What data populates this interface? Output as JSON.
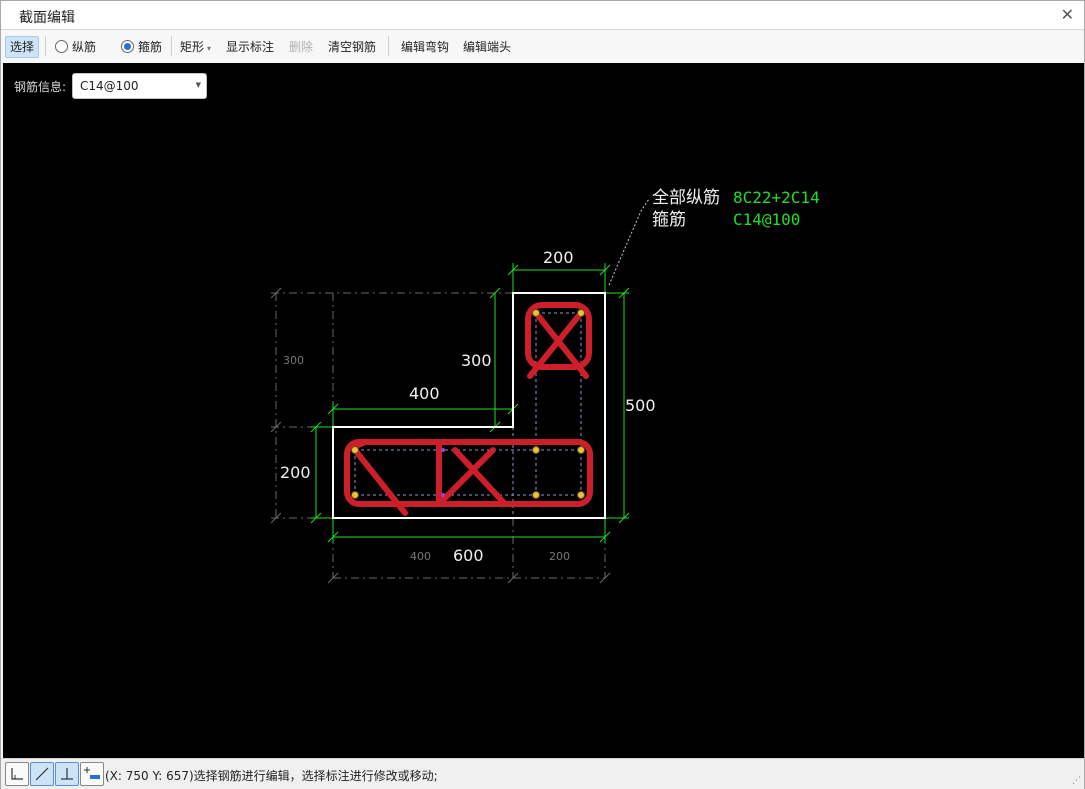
{
  "window": {
    "title": "截面编辑"
  },
  "toolbar": {
    "select": "选择",
    "radio_longitudinal": "纵筋",
    "radio_stirrup": "箍筋",
    "shape": "矩形",
    "show_dims": "显示标注",
    "delete": "删除",
    "clear_rebar": "清空钢筋",
    "edit_hook": "编辑弯钩",
    "edit_end": "编辑端头",
    "stirrup_checked": true
  },
  "rebar_info": {
    "label": "钢筋信息:",
    "value": "C14@100"
  },
  "drawing": {
    "annotation": {
      "all_longitudinal_label": "全部纵筋",
      "all_longitudinal_value": "8C22+2C14",
      "stirrup_label": "箍筋",
      "stirrup_value": "C14@100"
    },
    "dims": {
      "top_width": "200",
      "vertical_300": "300",
      "horizontal_400": "400",
      "right_500": "500",
      "left_200": "200",
      "bottom_600": "600",
      "ghost_300": "300",
      "ghost_400": "400",
      "ghost_200": "200"
    },
    "colors": {
      "background": "#000000",
      "outline": "#ffffff",
      "dimension": "#22dd22",
      "rebar": "#cc1f2a",
      "annotation_value": "#22dd22"
    }
  },
  "statusbar": {
    "text": "(X: 750 Y: 657)选择钢筋进行编辑，选择标注进行修改或移动;",
    "buttons": [
      "corner-snap-icon",
      "line-snap-icon",
      "perpendicular-icon",
      "add-dimension-icon"
    ]
  }
}
